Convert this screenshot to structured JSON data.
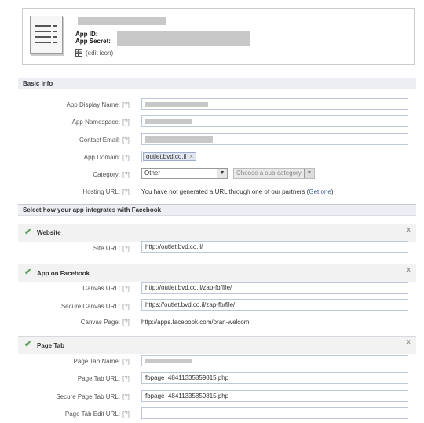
{
  "header": {
    "app_id_label": "App ID:",
    "app_secret_label": "App Secret:",
    "edit_icon_label": "(edit icon)"
  },
  "basic_info": {
    "title": "Basic info",
    "display_name_label": "App Display Name:",
    "namespace_label": "App Namespace:",
    "contact_email_label": "Contact Email:",
    "app_domain_label": "App Domain:",
    "app_domain_token": "outlet.bvd.co.il",
    "category_label": "Category:",
    "category_value": "Other",
    "subcategory_placeholder": "Choose a sub-category",
    "hosting_url_label": "Hosting URL:",
    "hosting_text": "You have not generated a URL through one of our partners (",
    "hosting_link": "Get one",
    "hosting_text_end": ")",
    "help": "[?]"
  },
  "integration": {
    "title": "Select how your app integrates with Facebook",
    "website": {
      "title": "Website",
      "site_url_label": "Site URL:",
      "site_url_value": "http://outlet.bvd.co.il/"
    },
    "app_on_facebook": {
      "title": "App on Facebook",
      "canvas_url_label": "Canvas URL:",
      "canvas_url_value": "http://outlet.bvd.co.il/zap-fb/file/",
      "secure_canvas_url_label": "Secure Canvas URL:",
      "secure_canvas_url_value": "https://outlet.bvd.co.il/zap-fb/file/",
      "canvas_page_label": "Canvas Page:",
      "canvas_page_value": "http://apps.facebook.com/oran-welcom"
    },
    "page_tab": {
      "title": "Page Tab",
      "tab_name_label": "Page Tab Name:",
      "tab_url_label": "Page Tab URL:",
      "tab_url_value": "fbpage_48411335859815.php",
      "secure_tab_url_label": "Secure Page Tab URL:",
      "secure_tab_url_value": "fbpage_48411335859815.php",
      "tab_edit_url_label": "Page Tab Edit URL:"
    }
  },
  "colors": {
    "link": "#3b5998",
    "check": "#5aa55a",
    "section_bg": "#eceef4"
  }
}
